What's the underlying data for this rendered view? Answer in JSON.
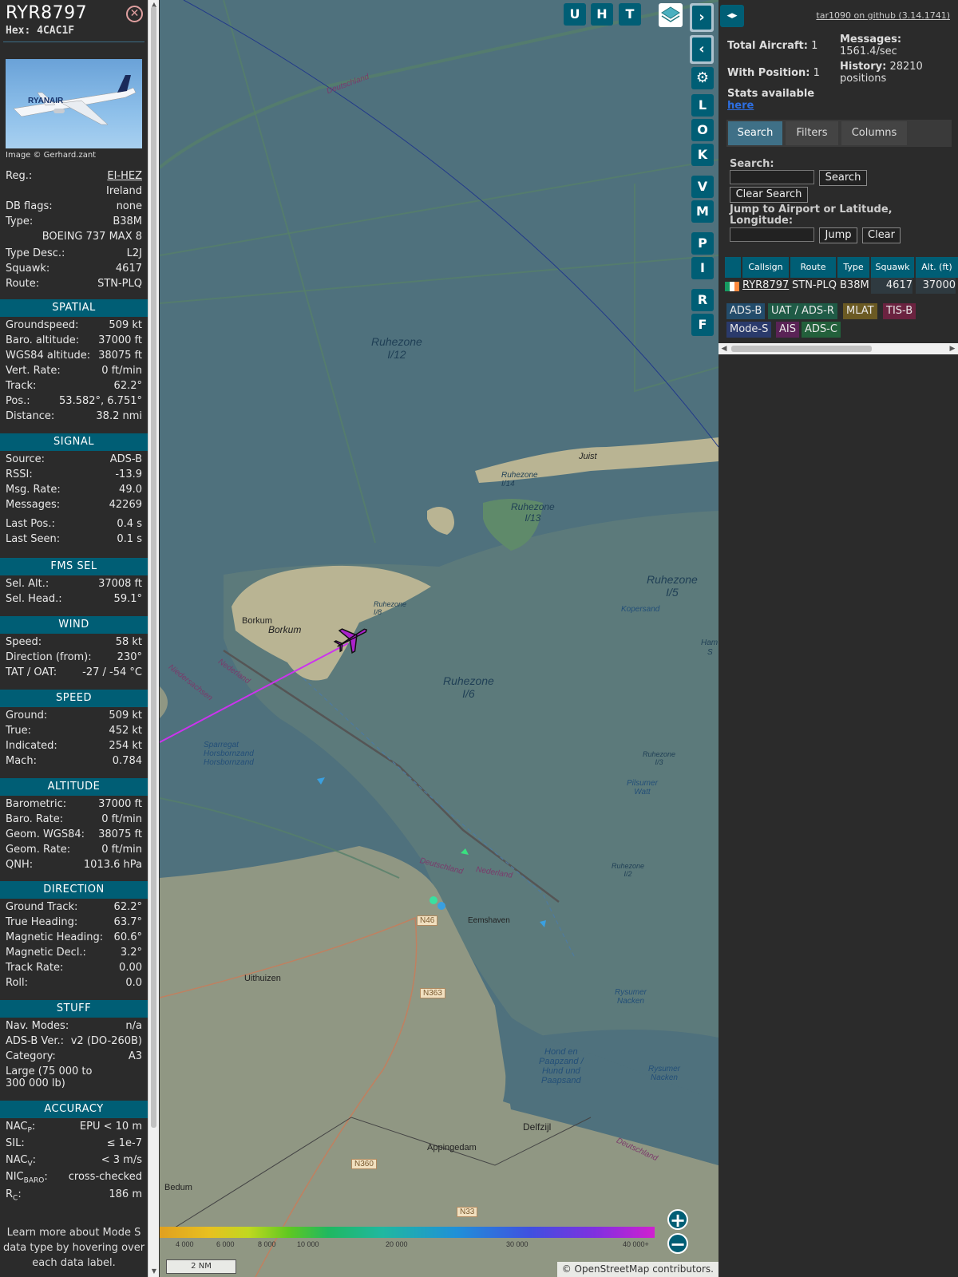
{
  "aircraft": {
    "callsign": "RYR8797",
    "hex": "Hex: 4CAC1F",
    "photo_credit": "Image © Gerhard.zant",
    "info": [
      {
        "k": "Reg.:",
        "v": "EI-HEZ"
      },
      {
        "k": "",
        "v": "Ireland"
      },
      {
        "k": "DB flags:",
        "v": "none"
      },
      {
        "k": "Type:",
        "v": "B38M"
      },
      {
        "k": "",
        "v": "BOEING 737 MAX 8"
      },
      {
        "k": "Type Desc.:",
        "v": "L2J"
      },
      {
        "k": "Squawk:",
        "v": "4617"
      },
      {
        "k": "Route:",
        "v": "STN-PLQ"
      }
    ]
  },
  "sections": {
    "spatial": {
      "title": "SPATIAL",
      "rows": [
        {
          "k": "Groundspeed:",
          "v": "509 kt"
        },
        {
          "k": "Baro. altitude:",
          "v": "37000 ft"
        },
        {
          "k": "WGS84 altitude:",
          "v": "38075 ft"
        },
        {
          "k": "Vert. Rate:",
          "v": "0 ft/min"
        },
        {
          "k": "Track:",
          "v": "62.2°"
        },
        {
          "k": "Pos.:",
          "v": "53.582°, 6.751°"
        },
        {
          "k": "Distance:",
          "v": "38.2 nmi"
        }
      ]
    },
    "signal": {
      "title": "SIGNAL",
      "rows": [
        {
          "k": "Source:",
          "v": "ADS-B"
        },
        {
          "k": "RSSI:",
          "v": "-13.9"
        },
        {
          "k": "Msg. Rate:",
          "v": "49.0"
        },
        {
          "k": "Messages:",
          "v": "42269"
        },
        {
          "k": "Last Pos.:",
          "v": "0.4 s"
        },
        {
          "k": "Last Seen:",
          "v": "0.1 s"
        }
      ]
    },
    "fms": {
      "title": "FMS SEL",
      "rows": [
        {
          "k": "Sel. Alt.:",
          "v": "37008 ft"
        },
        {
          "k": "Sel. Head.:",
          "v": "59.1°"
        }
      ]
    },
    "wind": {
      "title": "WIND",
      "rows": [
        {
          "k": "Speed:",
          "v": "58 kt"
        },
        {
          "k": "Direction (from):",
          "v": "230°"
        },
        {
          "k": "TAT / OAT:",
          "v": "-27 / -54 °C"
        }
      ]
    },
    "speed": {
      "title": "SPEED",
      "rows": [
        {
          "k": "Ground:",
          "v": "509 kt"
        },
        {
          "k": "True:",
          "v": "452 kt"
        },
        {
          "k": "Indicated:",
          "v": "254 kt"
        },
        {
          "k": "Mach:",
          "v": "0.784"
        }
      ]
    },
    "altitude": {
      "title": "ALTITUDE",
      "rows": [
        {
          "k": "Barometric:",
          "v": "37000 ft"
        },
        {
          "k": "Baro. Rate:",
          "v": "0 ft/min"
        },
        {
          "k": "Geom. WGS84:",
          "v": "38075 ft"
        },
        {
          "k": "Geom. Rate:",
          "v": "0 ft/min"
        },
        {
          "k": "QNH:",
          "v": "1013.6 hPa"
        }
      ]
    },
    "direction": {
      "title": "DIRECTION",
      "rows": [
        {
          "k": "Ground Track:",
          "v": "62.2°"
        },
        {
          "k": "True Heading:",
          "v": "63.7°"
        },
        {
          "k": "Magnetic Heading:",
          "v": "60.6°"
        },
        {
          "k": "Magnetic Decl.:",
          "v": "3.2°"
        },
        {
          "k": "Track Rate:",
          "v": "0.00"
        },
        {
          "k": "Roll:",
          "v": "0.0"
        }
      ]
    },
    "stuff": {
      "title": "STUFF",
      "rows": [
        {
          "k": "Nav. Modes:",
          "v": "n/a"
        },
        {
          "k": "ADS-B Ver.:",
          "v": "v2 (DO-260B)"
        },
        {
          "k": "Category:",
          "v": "A3"
        }
      ],
      "category_desc": "Large (75 000 to 300 000 lb)"
    },
    "accuracy": {
      "title": "ACCURACY",
      "rows": [
        {
          "k": "NAC",
          "sub": "P",
          "k2": ":",
          "v": "EPU < 10 m"
        },
        {
          "k": "SIL:",
          "sub": "",
          "k2": "",
          "v": "≤ 1e-7"
        },
        {
          "k": "NAC",
          "sub": "V",
          "k2": ":",
          "v": "< 3 m/s"
        },
        {
          "k": "NIC",
          "sub": "BARO",
          "k2": ":",
          "v": "cross-checked"
        },
        {
          "k": "R",
          "sub": "C",
          "k2": ":",
          "v": "186 m"
        }
      ]
    }
  },
  "note": "Learn more about Mode S data type by hovering over each data label.",
  "map": {
    "top_buttons": [
      "U",
      "H",
      "T"
    ],
    "side_buttons": [
      "L",
      "O",
      "K",
      "V",
      "M",
      "P",
      "I",
      "R",
      "F"
    ],
    "labels": {
      "deutschland_top": "Deutschland",
      "ruhezone_i12": "Ruhezone\nI/12",
      "juist": "Juist",
      "ruhezone_i14": "Ruhezone\nI/14",
      "ruhezone_i13": "Ruhezone\nI/13",
      "ruhezone_i5": "Ruhezone\nI/5",
      "kopersand": "Kopersand",
      "borkum_a": "Borkum",
      "borkum_b": "Borkum",
      "ruhezone_i8": "Ruhezone\nI/8",
      "ruhezone_i6": "Ruhezone\nI/6",
      "nederland_1": "Nederland",
      "niedersachsen": "Niedersachsen",
      "sparregat": "Sparregat\nHorsbornzand\nHorsbornzand",
      "ruhezone_i3": "Ruhezone\nI/3",
      "pilsumer_watt": "Pilsumer\nWatt",
      "deutschland_mid": "Deutschland",
      "nederland_mid": "Nederland",
      "ruhezone_i2": "Ruhezone\nI/2",
      "n46": "N46",
      "eemshaven": "Eemshaven",
      "uithuizen": "Uithuizen",
      "n363": "N363",
      "rysumer_nacken": "Rysumer\nNacken",
      "hond_en_paap": "Hond en\nPaapzand /\nHund und\nPaapsand",
      "rysumer_nacken2": "Rysumer\nNacken",
      "delfzijl": "Delfzijl",
      "appingedam": "Appingedam",
      "deutschland_bot": "Deutschland",
      "n360": "N360",
      "bedum": "Bedum",
      "n33": "N33",
      "ham": "Ham",
      "s": "S"
    },
    "color_scale_labels": [
      "4 000",
      "6 000",
      "8 000",
      "10 000",
      "20 000",
      "30 000",
      "40 000+"
    ],
    "scale": "2 NM",
    "attribution_prefix": "©",
    "attribution_link": "OpenStreetMap",
    "attribution_suffix": "contributors."
  },
  "sidebar": {
    "github": "tar1090 on github (3.14.1741)",
    "total_aircraft_label": "Total Aircraft:",
    "total_aircraft": "1",
    "with_position_label": "With Position:",
    "with_position": "1",
    "messages_label": "Messages:",
    "messages": "1561.4/sec",
    "history_label": "History:",
    "history": "28210 positions",
    "stats_label": "Stats available",
    "stats_link": "here",
    "tabs": [
      "Search",
      "Filters",
      "Columns"
    ],
    "search_label": "Search:",
    "search_button": "Search",
    "clear_search_button": "Clear Search",
    "jump_label": "Jump to Airport or Latitude, Longitude:",
    "jump_button": "Jump",
    "clear_button": "Clear",
    "table_headers": [
      "Callsign",
      "Route",
      "Type",
      "Squawk",
      "Alt. (ft)"
    ],
    "table_rows": [
      {
        "callsign": "RYR8797",
        "route": "STN-PLQ",
        "type": "B38M",
        "squawk": "4617",
        "alt": "37000"
      }
    ],
    "sources": [
      {
        "label": "ADS-B",
        "color": "#234c6b"
      },
      {
        "label": "UAT / ADS-R",
        "color": "#1f5b46"
      },
      {
        "label": "MLAT",
        "color": "#6b5a23"
      },
      {
        "label": "TIS-B",
        "color": "#6b2340"
      },
      {
        "label": "Mode-S",
        "color": "#2a3a6b"
      },
      {
        "label": "AIS",
        "color": "#5a2356"
      },
      {
        "label": "ADS-C",
        "color": "#23603b"
      }
    ]
  }
}
